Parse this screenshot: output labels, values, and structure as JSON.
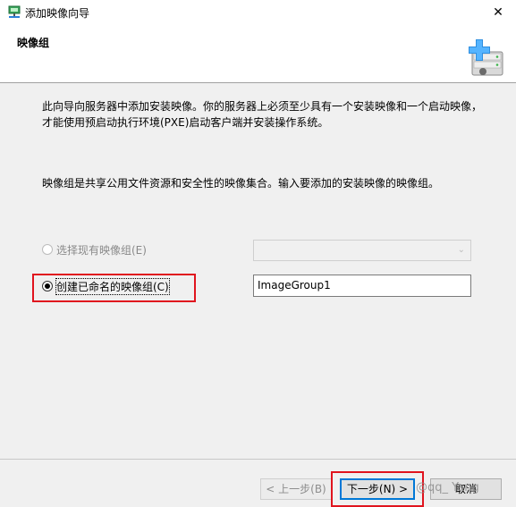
{
  "window": {
    "title": "添加映像向导",
    "close_glyph": "✕"
  },
  "header": {
    "title": "映像组"
  },
  "content": {
    "description": "此向导向服务器中添加安装映像。你的服务器上必须至少具有一个安装映像和一个启动映像，才能使用预启动执行环境(PXE)启动客户端并安装操作系统。",
    "group_description": "映像组是共享公用文件资源和安全性的映像集合。输入要添加的安装映像的映像组。",
    "options": {
      "existing_group": {
        "label": "选择现有映像组(E)",
        "selected": false,
        "enabled": false
      },
      "new_group": {
        "label": "创建已命名的映像组(C)",
        "selected": true,
        "enabled": true
      }
    },
    "existing_group_select": {
      "value": "",
      "arrow_glyph": "⌄"
    },
    "new_group_name": {
      "value": "ImageGroup1"
    }
  },
  "buttons": {
    "back": "< 上一步(B)",
    "next": "下一步(N) >",
    "cancel": "取消"
  },
  "watermark": "@qq_  Yang",
  "colors": {
    "highlight_red": "#e0141e",
    "focus_blue": "#0078d7",
    "window_bg": "#f0f0f0"
  },
  "icons": {
    "app": "network-computer-icon",
    "header": "add-server-plus-icon",
    "close": "close-icon"
  }
}
